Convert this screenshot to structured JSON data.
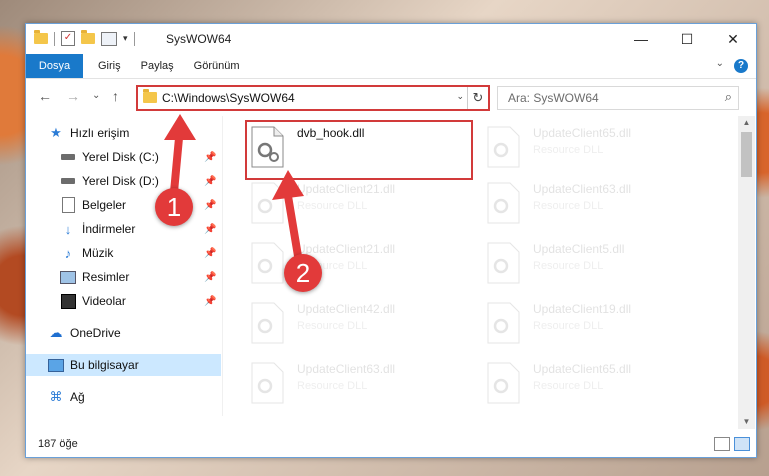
{
  "window": {
    "title": "SysWOW64",
    "qa_arrow": "▾",
    "controls": {
      "minimize": "—",
      "maximize": "☐",
      "close": "✕"
    }
  },
  "ribbon": {
    "file_tab": "Dosya",
    "tabs": [
      "Giriş",
      "Paylaş",
      "Görünüm"
    ],
    "expand": "⌄",
    "help": "?"
  },
  "address": {
    "path": "C:\\Windows\\SysWOW64",
    "back": "←",
    "forward": "→",
    "recent": "⌄",
    "up": "↑",
    "dropdown": "⌄",
    "refresh": "↻"
  },
  "search": {
    "placeholder": "Ara: SysWOW64",
    "icon": "⌕"
  },
  "nav": {
    "pin": "📌",
    "items": [
      {
        "label": "Hızlı erişim",
        "icon": "star-icon",
        "glyph": "★",
        "pinned": false
      },
      {
        "label": "Yerel Disk (C:)",
        "icon": "drive-icon",
        "pinned": true
      },
      {
        "label": "Yerel Disk (D:)",
        "icon": "drive-icon",
        "pinned": true
      },
      {
        "label": "Belgeler",
        "icon": "document-icon",
        "pinned": true
      },
      {
        "label": "İndirmeler",
        "icon": "download-icon",
        "glyph": "↓",
        "pinned": true
      },
      {
        "label": "Müzik",
        "icon": "music-icon",
        "glyph": "♪",
        "pinned": true
      },
      {
        "label": "Resimler",
        "icon": "picture-icon",
        "pinned": true
      },
      {
        "label": "Videolar",
        "icon": "video-icon",
        "pinned": true
      },
      {
        "label": "OneDrive",
        "icon": "cloud-icon",
        "glyph": "☁",
        "pinned": false
      },
      {
        "label": "Bu bilgisayar",
        "icon": "computer-icon",
        "pinned": false,
        "selected": true
      },
      {
        "label": "Ağ",
        "icon": "network-icon",
        "glyph": "⌘",
        "pinned": false
      }
    ]
  },
  "files": {
    "left": [
      {
        "name": "dvb_hook.dll",
        "desc": "",
        "highlighted": true
      },
      {
        "name": "UpdateClient21.dll",
        "desc": "Resource DLL"
      },
      {
        "name": "UpdateClient21.dll",
        "desc": "Resource DLL"
      },
      {
        "name": "UpdateClient42.dll",
        "desc": "Resource DLL"
      },
      {
        "name": "UpdateClient63.dll",
        "desc": "Resource DLL"
      }
    ],
    "right": [
      {
        "name": "UpdateClient65.dll",
        "desc": "Resource DLL"
      },
      {
        "name": "UpdateClient63.dll",
        "desc": "Resource DLL"
      },
      {
        "name": "UpdateClient5.dll",
        "desc": "Resource DLL"
      },
      {
        "name": "UpdateClient19.dll",
        "desc": "Resource DLL"
      },
      {
        "name": "UpdateClient65.dll",
        "desc": "Resource DLL"
      }
    ]
  },
  "scrollbar": {
    "up": "▲",
    "down": "▼"
  },
  "status": {
    "count": "187 öğe"
  },
  "annotations": {
    "step1": "1",
    "step2": "2",
    "color": "#e23a3a"
  }
}
